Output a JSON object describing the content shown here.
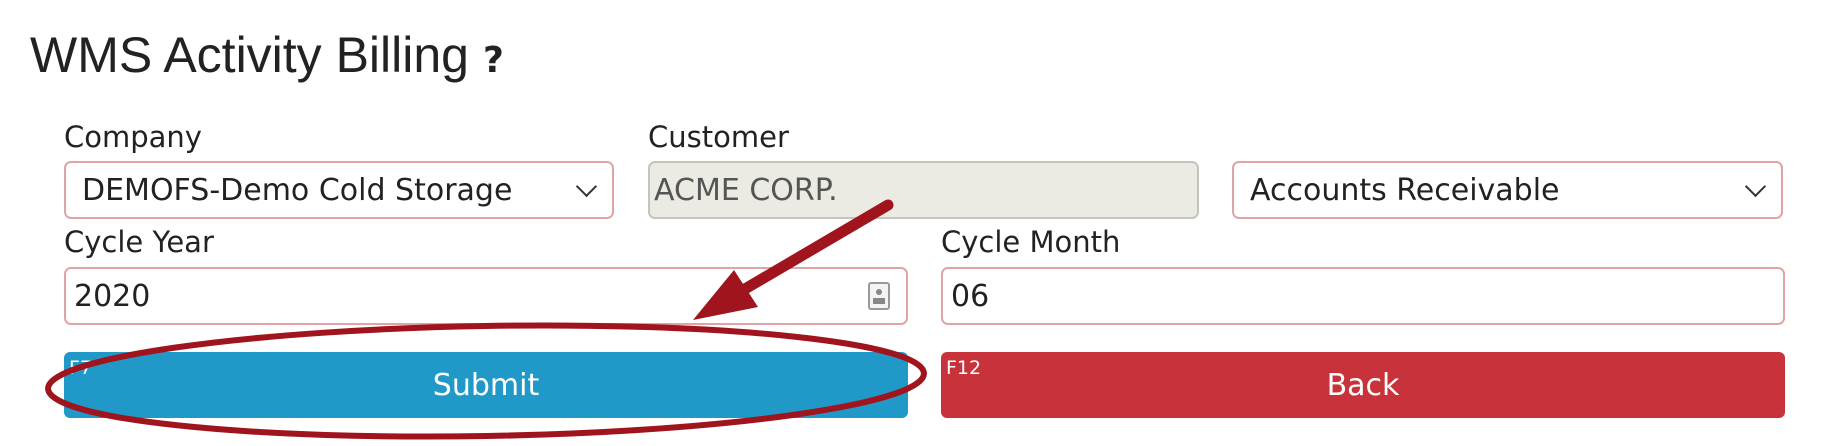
{
  "page": {
    "title": "WMS Activity Billing",
    "help_label": "?"
  },
  "form": {
    "company": {
      "label": "Company",
      "value": "DEMOFS-Demo Cold Storage"
    },
    "customer": {
      "label": "Customer",
      "value": "ACME CORP."
    },
    "account_type": {
      "value": "Accounts Receivable"
    },
    "cycle_year": {
      "label": "Cycle Year",
      "value": "2020"
    },
    "cycle_month": {
      "label": "Cycle Month",
      "value": "06"
    }
  },
  "actions": {
    "submit": {
      "label": "Submit",
      "shortcut": "F7",
      "color": "#2199c8"
    },
    "back": {
      "label": "Back",
      "shortcut": "F12",
      "color": "#c8333b"
    }
  },
  "annotation": {
    "color": "#a0141e",
    "icons": [
      "arrow-annotation",
      "ellipse-annotation"
    ]
  }
}
